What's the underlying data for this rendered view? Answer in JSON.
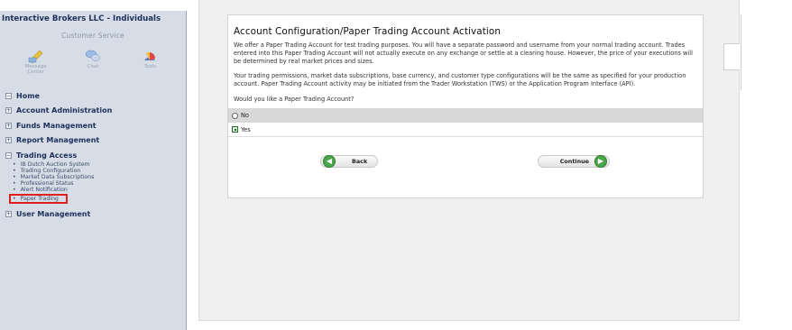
{
  "sidebar": {
    "brand": "Interactive Brokers LLC - Individuals",
    "customer_service": "Customer Service",
    "icons": [
      {
        "name": "message-center-icon",
        "label": "Message Center"
      },
      {
        "name": "chat-icon",
        "label": "Chat"
      },
      {
        "name": "tools-icon",
        "label": "Tools"
      }
    ],
    "nav": {
      "home": "Home",
      "account_administration": "Account Administration",
      "funds_management": "Funds Management",
      "report_management": "Report Management",
      "trading_access": "Trading Access",
      "user_management": "User Management"
    },
    "trading_access_items": [
      "IB Dutch Auction System",
      "Trading Configuration",
      "Market Data Subscriptions",
      "Professional Status",
      "Alert Notification",
      "Paper Trading"
    ]
  },
  "main": {
    "title": "Account Configuration/Paper Trading Account Activation",
    "para1": "We offer a Paper Trading Account for test trading purposes. You will have a separate password and username from your normal trading account. Trades entered into this Paper Trading Account will not actually execute on any exchange or settle at a clearing house. However, the price of your executions will be determined by real market prices and sizes.",
    "para2": "Your trading permissions, market data subscriptions, base currency, and customer type configurations will be the same as specified for your production account. Paper Trading Account activity may be initiated from the Trader Workstation (TWS) or the Application Program Interface (API).",
    "question": "Would you like a Paper Trading Account?",
    "option_no": "No",
    "option_yes": "Yes",
    "back_label": "Back",
    "continue_label": "Continue"
  }
}
